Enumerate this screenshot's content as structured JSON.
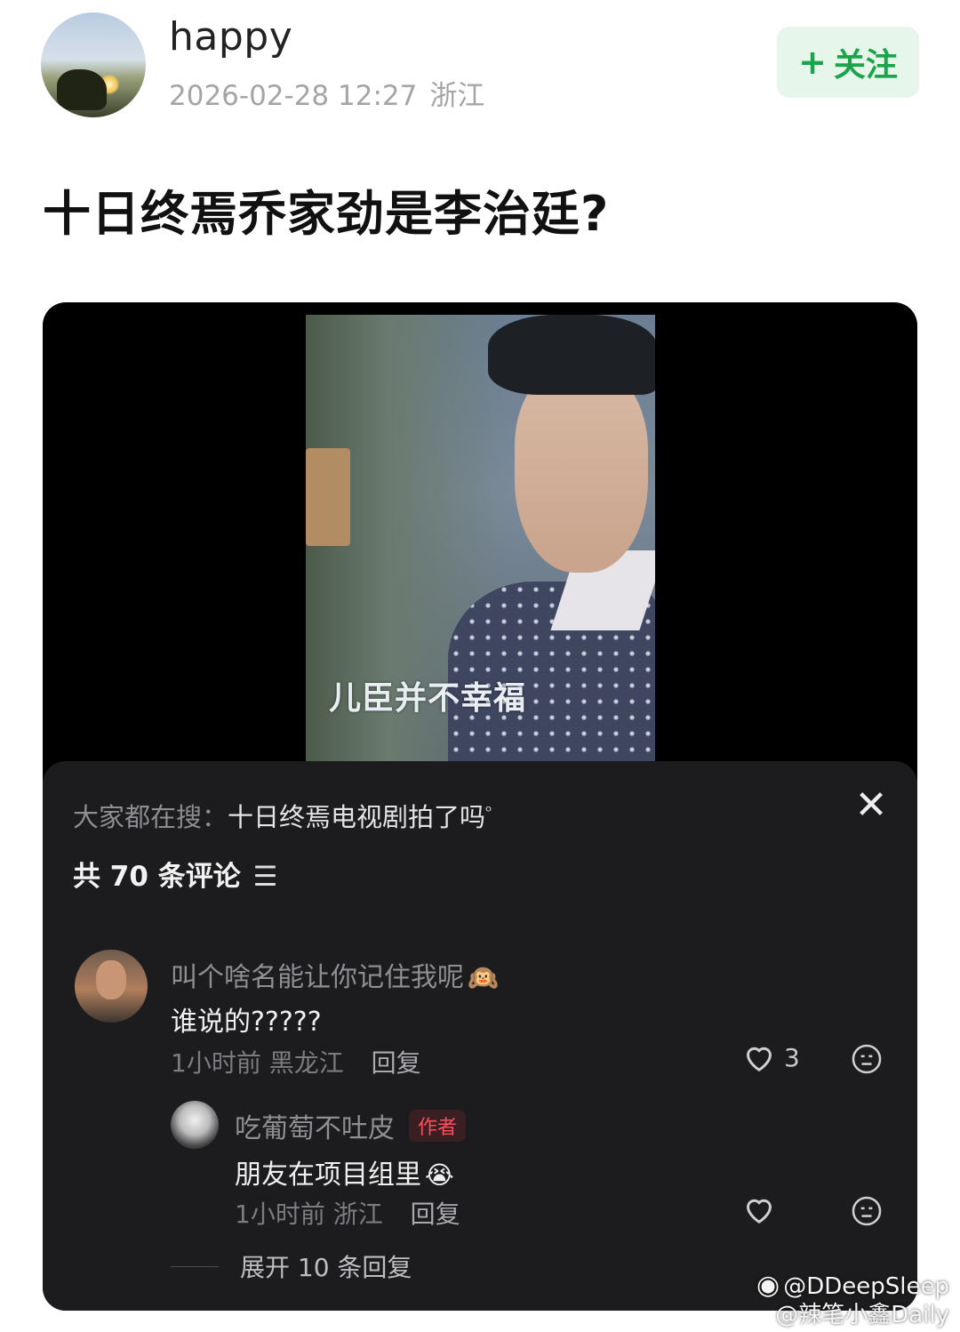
{
  "post": {
    "author": "happy",
    "timestamp": "2026-02-28 12:27",
    "location": "浙江",
    "follow_button": "关注",
    "title": "十日终焉乔家劲是李治廷?"
  },
  "video": {
    "subtitle": "儿臣并不幸福"
  },
  "comments_panel": {
    "search_prefix": "大家都在搜：",
    "search_keyword": "十日终焉电视剧拍了吗",
    "count_label": "共 70 条评论",
    "comments": [
      {
        "author": "叫个啥名能让你记住我呢",
        "author_emoji": "🙉",
        "text": "谁说的?????",
        "time": "1小时前",
        "location": "黑龙江",
        "reply_label": "回复",
        "likes": "3"
      },
      {
        "author": "吃葡萄不吐皮",
        "badge": "作者",
        "text": "朋友在项目组里",
        "text_emoji": "😭",
        "time": "1小时前",
        "location": "浙江",
        "reply_label": "回复",
        "likes": ""
      }
    ],
    "expand_label": "展开 10 条回复"
  },
  "watermark": {
    "line1": "@DDeepSleep",
    "line2": "@辣笔小鑫Daily"
  },
  "colors": {
    "follow_green": "#1aa54a",
    "follow_bg": "#e6f6ea",
    "panel_bg": "#1c1c1e",
    "author_badge_red": "#ff4d5e"
  },
  "icons": [
    "plus-icon",
    "close-icon",
    "filter-icon",
    "heart-icon",
    "dislike-face-icon",
    "search-icon",
    "weibo-logo-icon"
  ]
}
